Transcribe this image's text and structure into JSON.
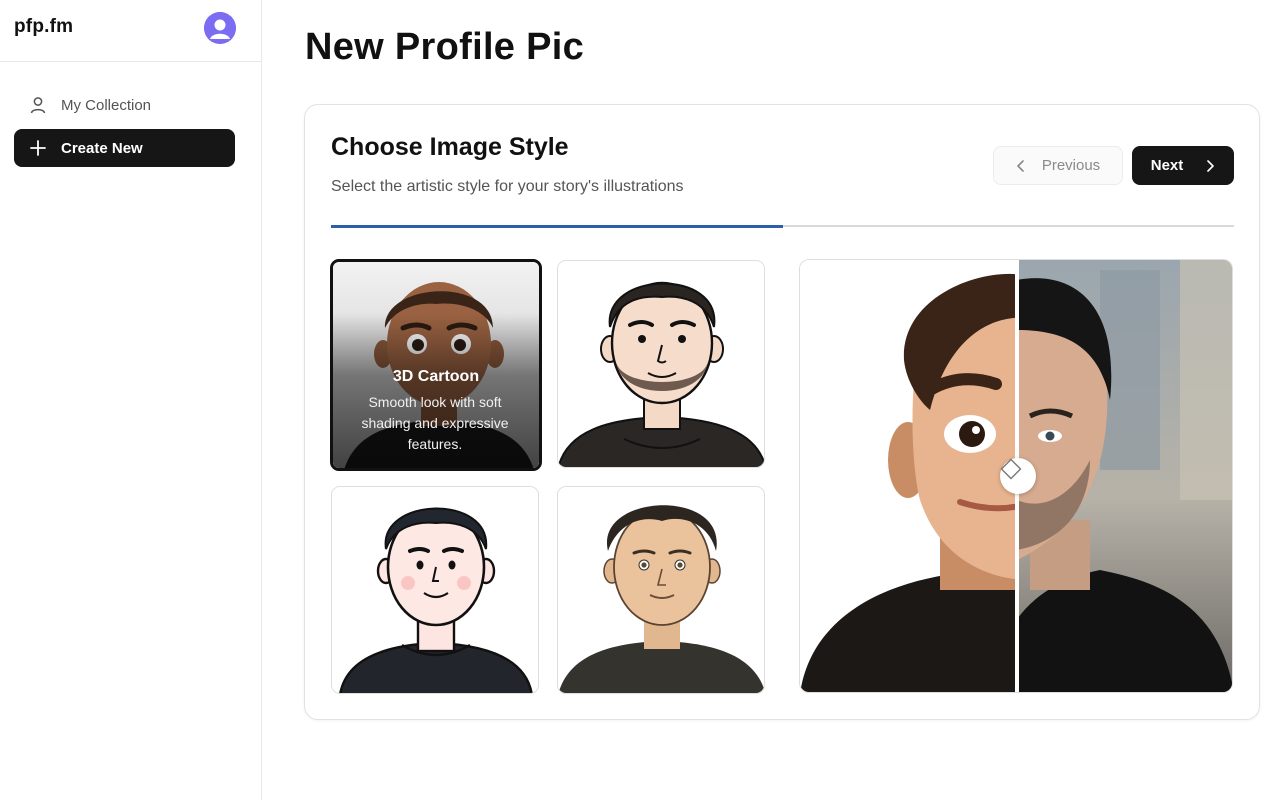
{
  "app": {
    "brand": "pfp.fm"
  },
  "sidebar": {
    "items": [
      {
        "label": "My Collection",
        "icon": "user-icon",
        "active": false
      },
      {
        "label": "Create New",
        "icon": "plus-icon",
        "active": true
      }
    ]
  },
  "main": {
    "title": "New Profile Pic",
    "step": {
      "title": "Choose Image Style",
      "subtitle": "Select the artistic style for your story's illustrations",
      "progress_fraction": 0.5,
      "previous_label": "Previous",
      "next_label": "Next"
    },
    "styles": [
      {
        "name": "3D Cartoon",
        "description": "Smooth look with soft shading and expressive features.",
        "selected": true
      },
      {
        "name": "",
        "description": "",
        "selected": false
      },
      {
        "name": "",
        "description": "",
        "selected": false
      },
      {
        "name": "",
        "description": "",
        "selected": false
      }
    ]
  },
  "colors": {
    "accent": "#2d5fa8",
    "primary_button": "#161616",
    "avatar": "#7b6cf2"
  }
}
